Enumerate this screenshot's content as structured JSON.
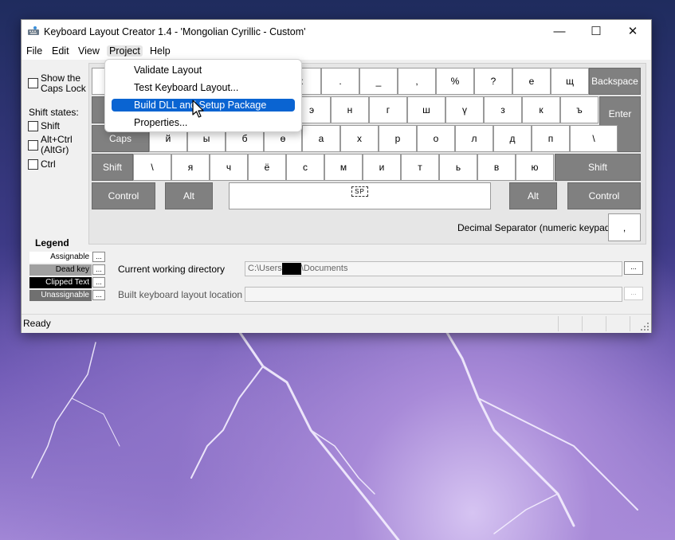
{
  "window": {
    "title": "Keyboard Layout Creator 1.4 - 'Mongolian Cyrillic - Custom'",
    "minimize": "—",
    "maximize": "☐",
    "close": "✕"
  },
  "menubar": {
    "items": [
      "File",
      "Edit",
      "View",
      "Project",
      "Help"
    ],
    "active": "Project"
  },
  "project_menu": {
    "items": [
      "Validate Layout",
      "Test Keyboard Layout...",
      "Build DLL and Setup Package",
      "Properties..."
    ],
    "highlighted": "Build DLL and Setup Package"
  },
  "left_panel": {
    "show_caps_lock": "Show the\nCaps Lock",
    "shift_states_label": "Shift states:",
    "shift": "Shift",
    "altgr": "Alt+Ctrl\n(AltGr)",
    "ctrl": "Ctrl"
  },
  "keyboard": {
    "row1": [
      ":",
      ".",
      "_",
      ",",
      "%",
      "?",
      "е",
      "щ"
    ],
    "row1_end": "Backspace",
    "row2": [
      "э",
      "н",
      "г",
      "ш",
      "ү",
      "з",
      "к",
      "ъ"
    ],
    "enter": "Enter",
    "caps": "Caps",
    "row3": [
      "й",
      "ы",
      "б",
      "ө",
      "а",
      "х",
      "р",
      "о",
      "л",
      "д",
      "п",
      "\\"
    ],
    "shift_left": "Shift",
    "row4": [
      "\\",
      "я",
      "ч",
      "ё",
      "с",
      "м",
      "и",
      "т",
      "ь",
      "в",
      "ю"
    ],
    "shift_right": "Shift",
    "control_left": "Control",
    "alt_left": "Alt",
    "space": "SP",
    "alt_right": "Alt",
    "control_right": "Control",
    "decimal_separator_label": "Decimal Separator (numeric keypad)",
    "decimal_separator_value": ","
  },
  "legend": {
    "title": "Legend",
    "items": [
      "Assignable",
      "Dead key",
      "Clipped Text",
      "Unassignable"
    ],
    "more": "..."
  },
  "fields": {
    "cwd_label": "Current working directory",
    "cwd_prefix": "C:\\Users",
    "cwd_suffix": "\\Documents",
    "built_label": "Built keyboard layout location",
    "built_value": "",
    "browse": "..."
  },
  "status": {
    "text": "Ready"
  },
  "colors": {
    "dark_key": "#808080",
    "highlight": "#0a64d2"
  }
}
